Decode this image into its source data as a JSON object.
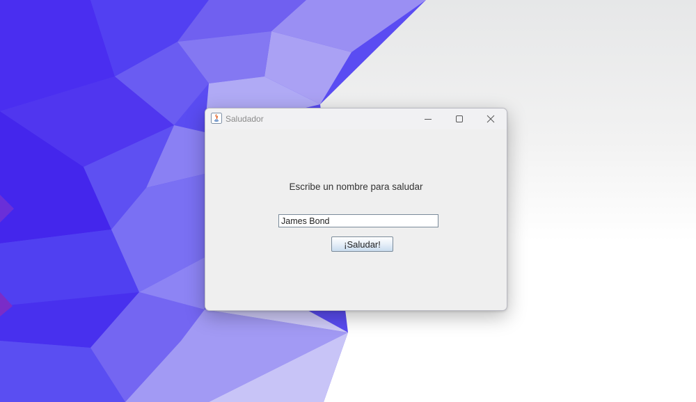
{
  "window": {
    "title": "Saludador",
    "app_icon": "java-icon",
    "controls": {
      "minimize_icon": "minimize-icon",
      "maximize_icon": "maximize-icon",
      "close_icon": "close-icon"
    }
  },
  "form": {
    "prompt_label": "Escribe un nombre para saludar",
    "name_input_value": "James Bond",
    "greet_button_label": "¡Saludar!"
  },
  "colors": {
    "wallpaper_primary": "#4a2ef0",
    "window_background": "#efefef",
    "titlebar_background": "#f1f1f3",
    "button_gradient_bottom": "#c9dcef"
  }
}
